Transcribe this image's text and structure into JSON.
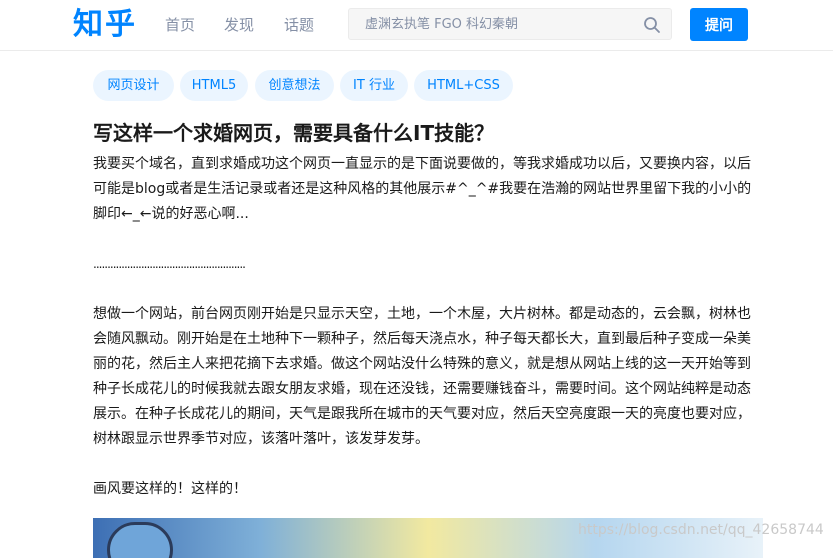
{
  "header": {
    "logo": "知乎",
    "nav": {
      "home": "首页",
      "discover": "发现",
      "topics": "话题"
    },
    "search_placeholder": "虚渊玄执笔 FGO 科幻秦朝",
    "ask_label": "提问"
  },
  "question": {
    "tags": [
      "网页设计",
      "HTML5",
      "创意想法",
      "IT 行业",
      "HTML+CSS"
    ],
    "title": "写这样一个求婚网页，需要具备什么IT技能？",
    "paragraphs": [
      "我要买个域名，直到求婚成功这个网页一直显示的是下面说要做的，等我求婚成功以后，又要换内容，以后可能是blog或者是生活记录或者还是这种风格的其他展示#^_^#我要在浩瀚的网站世界里留下我的小小的脚印←_←说的好恶心啊...",
      "......................................................",
      "想做一个网站，前台网页刚开始是只显示天空，土地，一个木屋，大片树林。都是动态的，云会飘，树林也会随风飘动。刚开始是在土地种下一颗种子，然后每天浇点水，种子每天都长大，直到最后种子变成一朵美丽的花，然后主人来把花摘下去求婚。做这个网站没什么特殊的意义，就是想从网站上线的这一天开始等到种子长成花儿的时候我就去跟女朋友求婚，现在还没钱，还需要赚钱奋斗，需要时间。这个网站纯粹是动态展示。在种子长成花儿的期间，天气是跟我所在城市的天气要对应，然后天空亮度跟一天的亮度也要对应，树林跟显示世界季节对应，该落叶落叶，该发芽发芽。",
      "画风要这样的！这样的！"
    ]
  },
  "watermark": "https://blog.csdn.net/qq_42658744",
  "colors": {
    "brand": "#0084ff",
    "tag_bg": "#ebf5ff",
    "nav_text": "#8590a6"
  }
}
